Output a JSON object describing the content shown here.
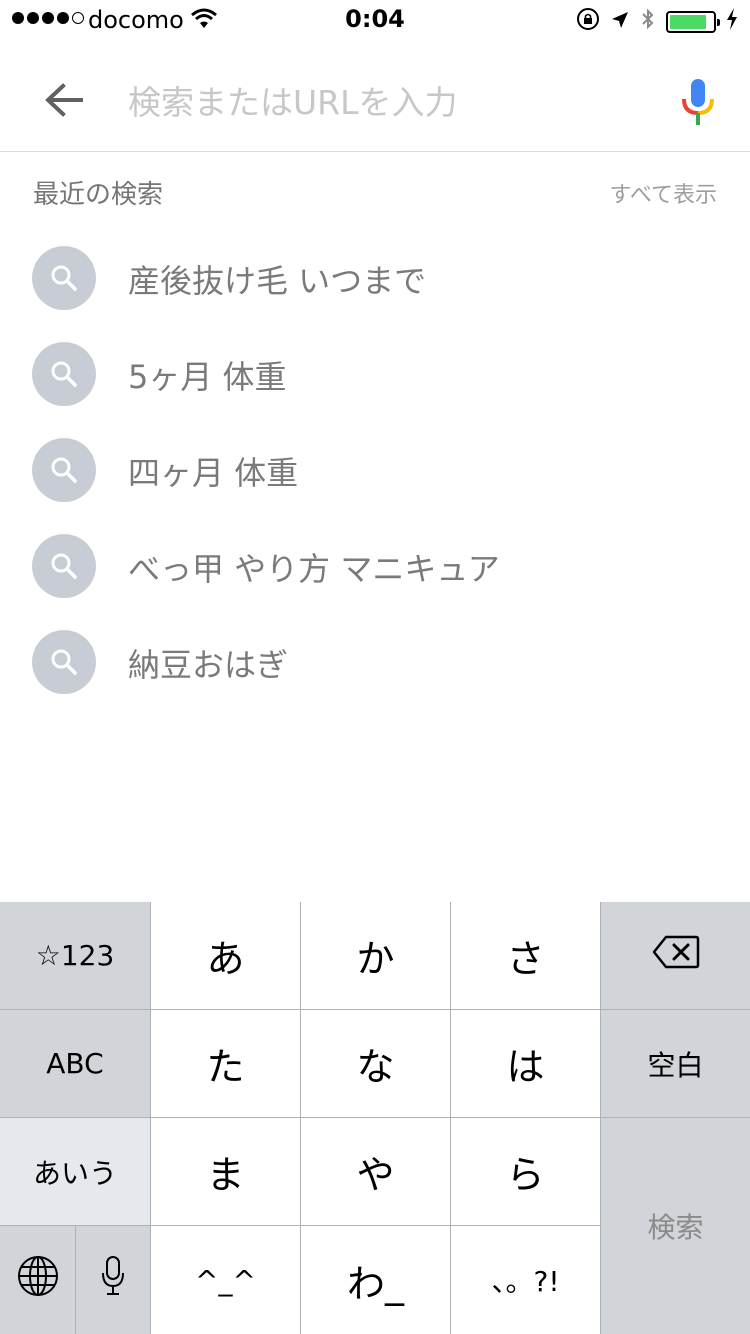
{
  "status_bar": {
    "carrier": "docomo",
    "time": "0:04",
    "battery_level": 0.85,
    "signal_bars": [
      true,
      true,
      true,
      true,
      false
    ],
    "battery_color": "#4cd964"
  },
  "search": {
    "placeholder": "検索またはURLを入力",
    "value": "",
    "back_icon": "arrow-left-icon",
    "mic_icon": "google-mic-icon"
  },
  "recent": {
    "title": "最近の検索",
    "show_all": "すべて表示",
    "items": [
      {
        "text": "産後抜け毛 いつまで",
        "icon": "search-icon"
      },
      {
        "text": "5ヶ月 体重",
        "icon": "search-icon"
      },
      {
        "text": "四ヶ月 体重",
        "icon": "search-icon"
      },
      {
        "text": "べっ甲 やり方 マニキュア",
        "icon": "search-icon"
      },
      {
        "text": "納豆おはぎ",
        "icon": "search-icon"
      }
    ]
  },
  "keyboard": {
    "k_123": "☆123",
    "k_a": "あ",
    "k_ka": "か",
    "k_sa": "さ",
    "k_abc": "ABC",
    "k_ta": "た",
    "k_na": "な",
    "k_ha": "は",
    "k_space": "空白",
    "k_aiu": "あいう",
    "k_ma": "ま",
    "k_ya": "や",
    "k_ra": "ら",
    "k_search": "検索",
    "k_emoticon": "^_^",
    "k_wa": "わ_",
    "k_punct": "、。?!"
  }
}
